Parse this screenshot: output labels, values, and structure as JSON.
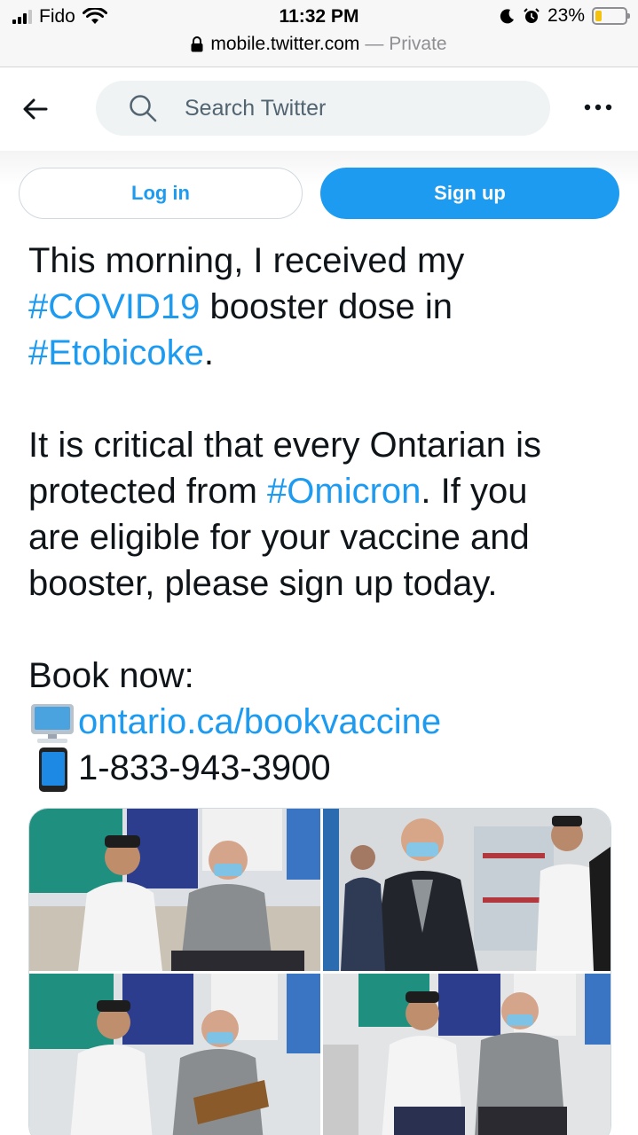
{
  "status_bar": {
    "carrier": "Fido",
    "time": "11:32 PM",
    "battery": "23%",
    "battery_level": 0.23,
    "icons": [
      "signal-icon",
      "wifi-icon",
      "moon-icon",
      "alarm-icon",
      "battery-icon"
    ]
  },
  "browser": {
    "host": "mobile.twitter.com",
    "mode": "— Private"
  },
  "header": {
    "search_placeholder": "Search Twitter"
  },
  "auth": {
    "login": "Log in",
    "signup": "Sign up"
  },
  "tweet": {
    "p1_l1": "This morning, I received my",
    "p1_l2_tag": "#COVID19",
    "p1_l2_rest": " booster dose in",
    "p1_l3_tag": "#Etobicoke",
    "p1_l3_rest": ".",
    "p2_l1": "It is critical that every Ontarian is",
    "p2_l2_a": "protected from ",
    "p2_l2_tag": "#Omicron",
    "p2_l2_b": ". If you",
    "p2_l3": "are eligible for your vaccine and",
    "p2_l4": "booster, please sign up today.",
    "p3_l1": "Book now:",
    "link": "ontario.ca/bookvaccine",
    "phone": "1-833-943-3900"
  },
  "media": {
    "photos": [
      "vaccination-photo",
      "walking-photo",
      "signing-photo",
      "seated-photo"
    ]
  },
  "colors": {
    "twitter_blue": "#1d9bf0",
    "text": "#0f1419",
    "secondary": "#536471",
    "battery_yellow": "#f4c20d"
  }
}
